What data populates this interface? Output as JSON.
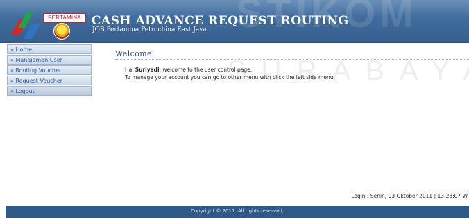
{
  "header": {
    "logo_text": "PERTAMINA",
    "title": "CASH ADVANCE REQUEST ROUTING",
    "subtitle": "JOB Pertamina Petrochina East Java",
    "watermark": "STIKOM"
  },
  "sidebar": {
    "items": [
      {
        "label": "» Home"
      },
      {
        "label": "» Manajemen User"
      },
      {
        "label": "» Routing Voucher"
      },
      {
        "label": "» Request Voucher"
      },
      {
        "label": "» Logout"
      }
    ]
  },
  "main": {
    "title": "Welcome",
    "line1_prefix": "Hai ",
    "user_name": "Suriyadi",
    "line1_suffix": ", welcome to the user control page.",
    "line2": "To manage your account you can go to other menu with click the left side menu.",
    "watermark": "SURABAYA"
  },
  "status": {
    "login_info": "Login : Senin, 03 Oktober 2011 | 13:23:07 W"
  },
  "footer": {
    "copyright": "Copyright © 2011. All rights reserved."
  },
  "colors": {
    "header_bg": "#3d6a9a",
    "menu_text": "#2a5ea0",
    "footer_bg": "#2f5a88"
  }
}
